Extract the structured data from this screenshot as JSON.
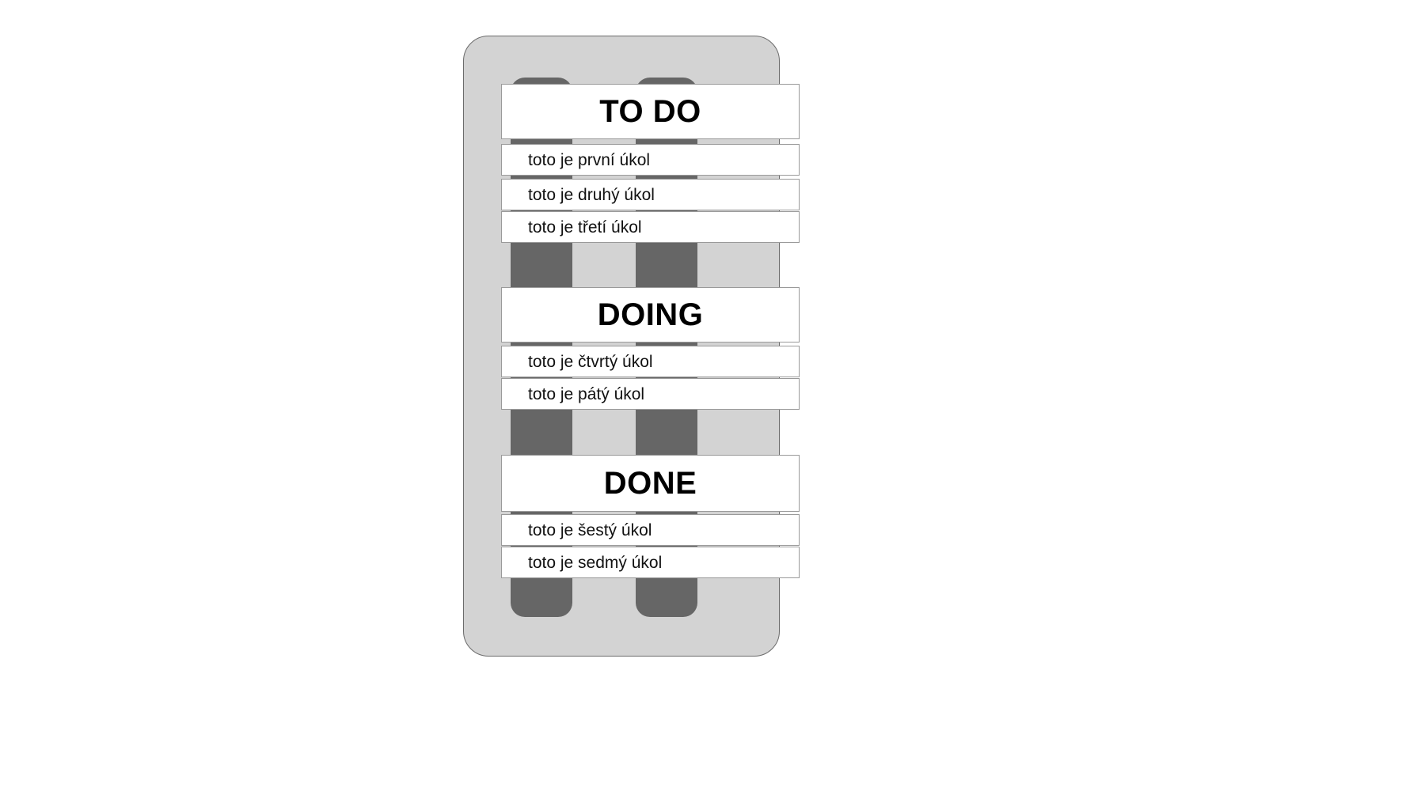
{
  "device": {
    "frame_color": "#d3d3d3",
    "frame_border_color": "#6b6b6b",
    "column_color": "#666666",
    "card_bg": "#ffffff",
    "card_border": "#9a9a9a",
    "text_color": "#000000"
  },
  "board": {
    "sections": [
      {
        "title": "TO DO",
        "tasks": [
          {
            "label": "toto je první úkol"
          },
          {
            "label": "toto je druhý úkol"
          },
          {
            "label": "toto je třetí úkol"
          }
        ]
      },
      {
        "title": "DOING",
        "tasks": [
          {
            "label": "toto je čtvrtý úkol"
          },
          {
            "label": "toto je pátý úkol"
          }
        ]
      },
      {
        "title": "DONE",
        "tasks": [
          {
            "label": "toto je šestý úkol"
          },
          {
            "label": "toto je sedmý úkol"
          }
        ]
      }
    ]
  }
}
